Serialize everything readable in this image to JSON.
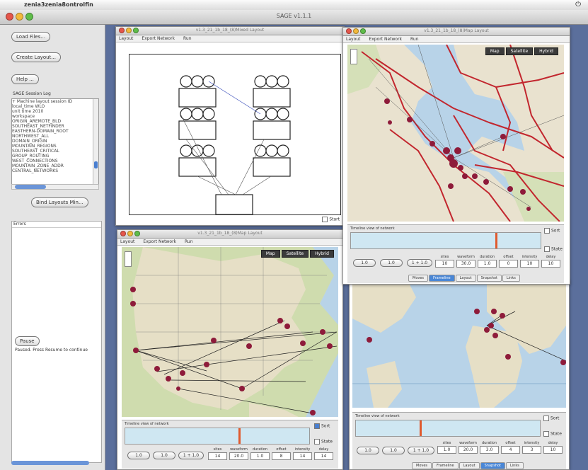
{
  "menubar": {
    "app_name": "zenia3zenia8ontrolfin"
  },
  "main_window": {
    "title": "SAGE v1.1.1"
  },
  "left_panel": {
    "buttons": {
      "load_files": "Load Files...",
      "create_layout": "Create Layout...",
      "help": "Help ...",
      "bind": "Bind Layouts Min...",
      "pause": "Pause"
    },
    "session_label": "SAGE Session Log",
    "tree_lines": [
      "+ Machine layout session ID",
      "  local_time WLO",
      "  unit time 2010",
      "  workspace",
      "       ORIGIN_AREMOTE_BLD",
      "       SOUTHEAST_NETFINDER",
      "       EASTHERN-DOMAIN_ROOT",
      "       NORTHWEST_ALL",
      "       DOMAIN_ORIGIN",
      "       MOUNTAIN_REGIONS",
      "       SOUTHEAST_CRITICAL",
      "       GROUP_ROUTING",
      "       WEST_CONNECTIONS",
      "       MOUNTAIN_ZONE_ADDR",
      "       CENTRAL_NETWORKS"
    ],
    "console_header": "Errors",
    "status_text": "Paused. Press Resume to continue"
  },
  "windows": {
    "diagram": {
      "title": "v1.3_21_1b_18_(8)Mixed Layout",
      "menu": [
        "Layout",
        "Export Network",
        "Run"
      ],
      "start_label": "Start"
    },
    "sf_map": {
      "title": "v1.3_21_1b_18_(8)Map Layout",
      "menu": [
        "Layout",
        "Export Network",
        "Run"
      ],
      "map_buttons": [
        "Map",
        "Satellite",
        "Hybrid"
      ],
      "timeline_label": "Timeline view of network",
      "sort_label": "Sort",
      "state_label": "State",
      "steps": [
        "1.0",
        "1.0",
        "1 + 1.0"
      ],
      "fields": [
        {
          "label": "sites",
          "value": "10"
        },
        {
          "label": "waveform",
          "value": "30.0"
        },
        {
          "label": "duration",
          "value": "1.0"
        },
        {
          "label": "offset",
          "value": "0"
        },
        {
          "label": "intensity",
          "value": "10"
        },
        {
          "label": "delay",
          "value": "10"
        }
      ],
      "tabs": [
        "Moves",
        "Frameline",
        "Layout",
        "Snapshot",
        "Links"
      ]
    },
    "us_map": {
      "title": "v1.3_21_1b_18_(8)Map Layout",
      "menu": [
        "Layout",
        "Export Network",
        "Run"
      ],
      "map_buttons": [
        "Map",
        "Satellite",
        "Hybrid"
      ],
      "timeline_label": "Timeline view of network",
      "sort_label": "Sort",
      "state_label": "State",
      "steps": [
        "1.0",
        "1.0",
        "1 + 1.0"
      ],
      "fields": [
        {
          "label": "sites",
          "value": "14"
        },
        {
          "label": "waveform",
          "value": "20.0"
        },
        {
          "label": "duration",
          "value": "1.0"
        },
        {
          "label": "offset",
          "value": "8"
        },
        {
          "label": "intensity",
          "value": "14"
        },
        {
          "label": "delay",
          "value": "14"
        }
      ]
    },
    "world_map": {
      "timeline_label": "Timeline view of network",
      "sort_label": "Sort",
      "state_label": "State",
      "steps": [
        "1.0",
        "1.0",
        "1 + 1.0"
      ],
      "fields": [
        {
          "label": "sites",
          "value": "1.0"
        },
        {
          "label": "waveform",
          "value": "20.0"
        },
        {
          "label": "duration",
          "value": "3.0"
        },
        {
          "label": "offset",
          "value": "4"
        },
        {
          "label": "intensity",
          "value": "3"
        },
        {
          "label": "delay",
          "value": "10"
        }
      ],
      "tabs": [
        "Moves",
        "Frameline",
        "Layout",
        "Snapshot",
        "Links"
      ]
    }
  },
  "colors": {
    "desktop": "#5b6f9c",
    "node": "#8e1b3a",
    "road": "#c2262e",
    "water": "#b8d3e8",
    "land": "#e9e2cf"
  }
}
